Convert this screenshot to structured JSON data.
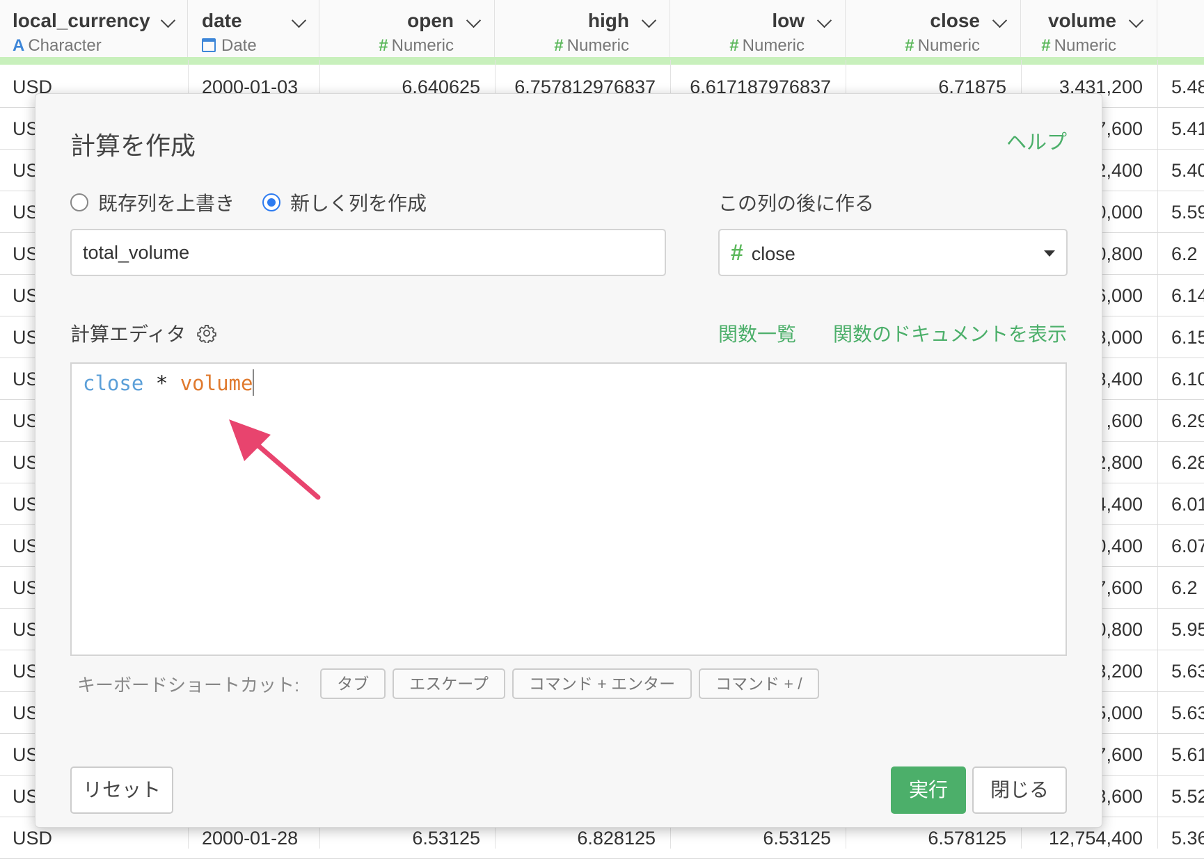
{
  "columns": [
    {
      "name": "local_currency",
      "type": "Character",
      "icon": "A"
    },
    {
      "name": "date",
      "type": "Date",
      "icon": "calendar"
    },
    {
      "name": "open",
      "type": "Numeric",
      "icon": "#"
    },
    {
      "name": "high",
      "type": "Numeric",
      "icon": "#"
    },
    {
      "name": "low",
      "type": "Numeric",
      "icon": "#"
    },
    {
      "name": "close",
      "type": "Numeric",
      "icon": "#"
    },
    {
      "name": "volume",
      "type": "Numeric",
      "icon": "#"
    }
  ],
  "rows_top": {
    "first": [
      "USD",
      "2000-01-03",
      "6.640625",
      "6.757812976837",
      "6.617187976837",
      "6.71875",
      "3,431,200",
      "5.48"
    ],
    "last": [
      "USD",
      "2000-01-28",
      "6.53125",
      "6.828125",
      "6.53125",
      "6.578125",
      "12,754,400",
      "5.36"
    ]
  },
  "side_rows": [
    {
      "c0": "US",
      "vol": "7,600",
      "x": "5.41"
    },
    {
      "c0": "US",
      "vol": "2,400",
      "x": "5.40"
    },
    {
      "c0": "US",
      "vol": "0,000",
      "x": "5.59"
    },
    {
      "c0": "US",
      "vol": "0,800",
      "x": "6.2"
    },
    {
      "c0": "US",
      "vol": "6,000",
      "x": "6.14"
    },
    {
      "c0": "US",
      "vol": "8,000",
      "x": "6.15"
    },
    {
      "c0": "US",
      "vol": "8,400",
      "x": "6.10"
    },
    {
      "c0": "US",
      "vol": ",600",
      "x": "6.29"
    },
    {
      "c0": "US",
      "vol": "2,800",
      "x": "6.28"
    },
    {
      "c0": "US",
      "vol": "4,400",
      "x": "6.01"
    },
    {
      "c0": "US",
      "vol": "0,400",
      "x": "6.07"
    },
    {
      "c0": "US",
      "vol": "7,600",
      "x": "6.2"
    },
    {
      "c0": "US",
      "vol": "0,800",
      "x": "5.95"
    },
    {
      "c0": "US",
      "vol": "3,200",
      "x": "5.63"
    },
    {
      "c0": "US",
      "vol": "5,000",
      "x": "5.63"
    },
    {
      "c0": "US",
      "vol": "7,600",
      "x": "5.61"
    },
    {
      "c0": "US",
      "vol": "3,600",
      "x": "5.52"
    }
  ],
  "modal": {
    "title": "計算を作成",
    "help_link": "ヘルプ",
    "radio_overwrite": "既存列を上書き",
    "radio_new": "新しく列を作成",
    "after_label": "この列の後に作る",
    "new_column_name": "total_volume",
    "after_column": "close",
    "after_column_icon": "#",
    "editor_label": "計算エディタ",
    "function_list_link": "関数一覧",
    "function_docs_link": "関数のドキュメントを表示",
    "expression": {
      "token1": "close",
      "operator": "*",
      "token2": "volume"
    },
    "shortcuts_label": "キーボードショートカット:",
    "shortcuts": [
      "タブ",
      "エスケープ",
      "コマンド + エンター",
      "コマンド + /"
    ],
    "reset_button": "リセット",
    "run_button": "実行",
    "close_button": "閉じる"
  },
  "colors": {
    "accent_green": "#4caf6a",
    "radio_blue": "#2d7bf0",
    "arrow_pink": "#e8446e"
  }
}
